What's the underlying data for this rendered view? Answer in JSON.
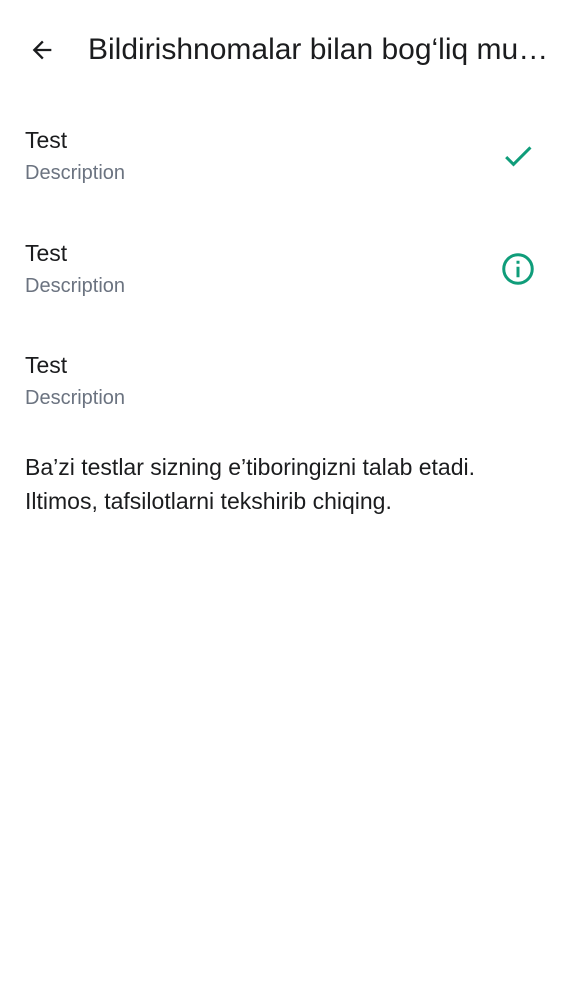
{
  "header": {
    "title": "Bildirishnomalar bilan bog‘liq muammolar",
    "back_icon": "arrow-left-icon"
  },
  "tests": [
    {
      "title": "Test",
      "description": "Description",
      "status": "passed",
      "icon": "check-icon"
    },
    {
      "title": "Test",
      "description": "Description",
      "status": "info",
      "icon": "info-circle-icon"
    },
    {
      "title": "Test",
      "description": "Description",
      "status": "none",
      "icon": ""
    }
  ],
  "message": "Ba’zi testlar sizning e’tiboringizni talab etadi. Iltimos, tafsilotlarni tekshirib chiqing.",
  "colors": {
    "accent": "#0f9d7a",
    "text_primary": "#1b1c1e",
    "text_secondary": "#6b7380",
    "background": "#ffffff"
  }
}
